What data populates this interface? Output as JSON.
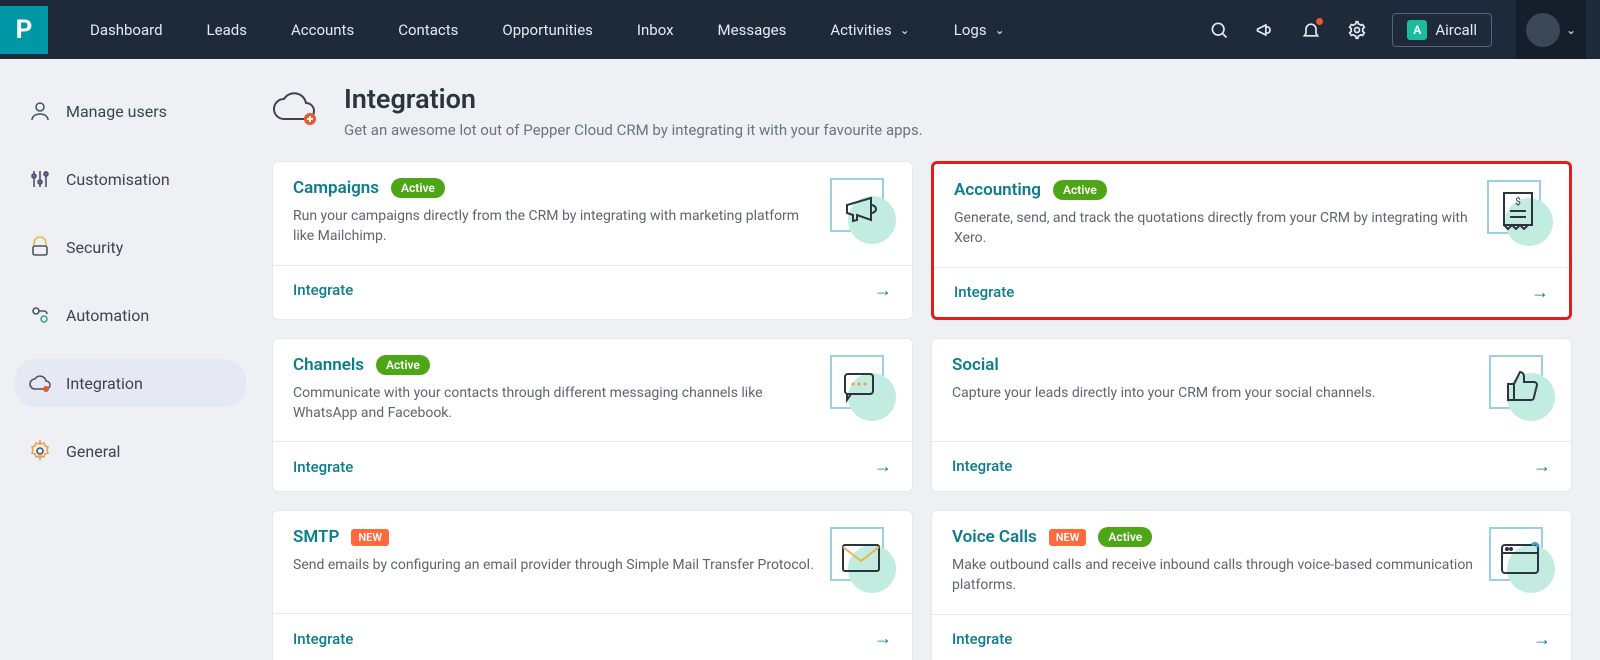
{
  "topnav": {
    "items": [
      "Dashboard",
      "Leads",
      "Accounts",
      "Contacts",
      "Opportunities",
      "Inbox",
      "Messages",
      "Activities",
      "Logs"
    ],
    "aircall": "Aircall",
    "aircall_badge": "A"
  },
  "sidebar": {
    "items": [
      {
        "label": "Manage users"
      },
      {
        "label": "Customisation"
      },
      {
        "label": "Security"
      },
      {
        "label": "Automation"
      },
      {
        "label": "Integration"
      },
      {
        "label": "General"
      }
    ]
  },
  "page": {
    "title": "Integration",
    "subtitle": "Get an awesome lot out of Pepper Cloud CRM by integrating it with your favourite apps."
  },
  "cards": [
    {
      "title": "Campaigns",
      "badge": "Active",
      "badge_type": "active",
      "desc": "Run your campaigns directly from the CRM by integrating with marketing platform like Mailchimp.",
      "action": "Integrate",
      "icon": "megaphone"
    },
    {
      "title": "Accounting",
      "badge": "Active",
      "badge_type": "active",
      "desc": "Generate, send, and track the quotations directly from your CRM by integrating with Xero.",
      "action": "Integrate",
      "icon": "receipt",
      "highlight": true
    },
    {
      "title": "Channels",
      "badge": "Active",
      "badge_type": "active",
      "desc": "Communicate with your contacts through different messaging channels like WhatsApp and Facebook.",
      "action": "Integrate",
      "icon": "chat"
    },
    {
      "title": "Social",
      "badge": "",
      "badge_type": "",
      "desc": "Capture your leads directly into your CRM from your social channels.",
      "action": "Integrate",
      "icon": "thumbs"
    },
    {
      "title": "SMTP",
      "badge": "NEW",
      "badge_type": "new",
      "desc": "Send emails by configuring an email provider through Simple Mail Transfer Protocol.",
      "action": "Integrate",
      "icon": "mail"
    },
    {
      "title": "Voice Calls",
      "badge": "NEW",
      "badge_type": "new",
      "badge2": "Active",
      "desc": "Make outbound calls and receive inbound calls through voice-based communication platforms.",
      "action": "Integrate",
      "icon": "browser"
    }
  ]
}
